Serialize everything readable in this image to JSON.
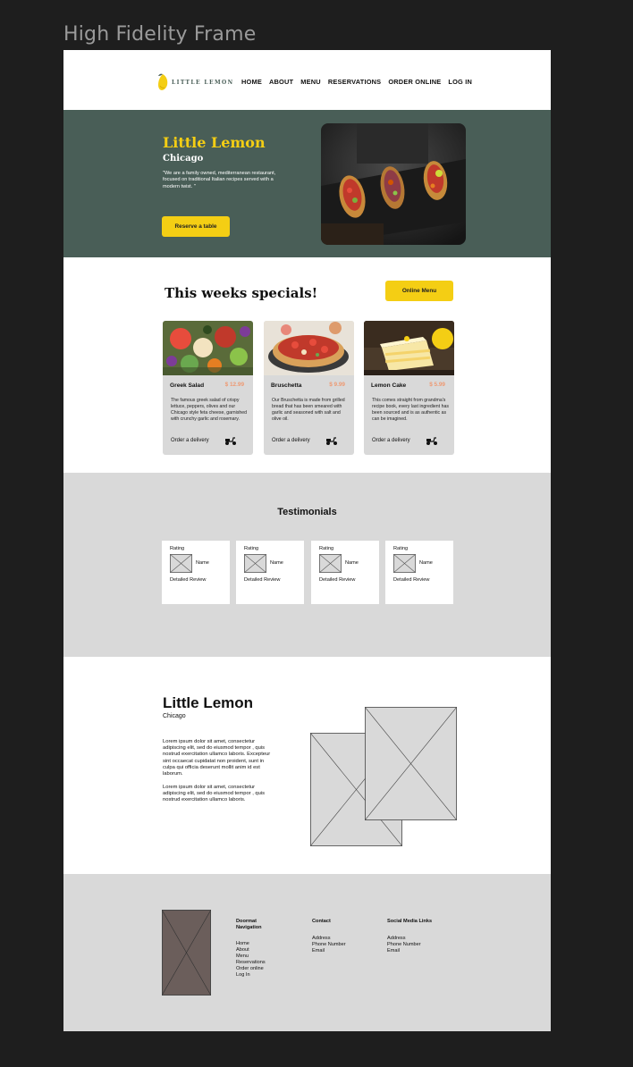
{
  "frame_label": "High Fidelity Frame",
  "nav": {
    "logo_text": "LITTLE LEMON",
    "items": [
      "HOME",
      "ABOUT",
      "MENU",
      "RESERVATIONS",
      "ORDER ONLINE",
      "LOG IN"
    ]
  },
  "hero": {
    "title": "Little Lemon",
    "subtitle": "Chicago",
    "description": "\"We are a family owned, mediterranean restaurant, focused on traditional Italian recipes served with a modern twist. \"",
    "button": "Reserve a table"
  },
  "specials": {
    "title": "This weeks specials!",
    "button": "Online Menu",
    "order_label": "Order a delivery",
    "cards": [
      {
        "name": "Greek Salad",
        "price": "$ 12.99",
        "desc": "The famous greek salad of crispy lettuce, peppers, olives and our Chicago style feta cheese, garnished with crunchy garlic and rosemary."
      },
      {
        "name": "Bruschetta",
        "price": "$ 9.99",
        "desc": "Our Bruschetta is made from grilled bread that has been smeared with garlic and seasoned with salt and olive oil."
      },
      {
        "name": "Lemon Cake",
        "price": "$ 5.99",
        "desc": "This comes straight from grandma's recipe book, every last ingredient has been sourced and is as authentic as can be imagined."
      }
    ]
  },
  "testimonials": {
    "title": "Testimonials",
    "cards": [
      {
        "rating": "Rating",
        "name": "Name",
        "review": "Detailed Review"
      },
      {
        "rating": "Rating",
        "name": "Name",
        "review": "Detailed Review"
      },
      {
        "rating": "Rating",
        "name": "Name",
        "review": "Detailed Review"
      },
      {
        "rating": "Rating",
        "name": "Name",
        "review": "Detailed Review"
      }
    ]
  },
  "about": {
    "title": "Little Lemon",
    "subtitle": "Chicago",
    "p1": "Lorem ipsum dolor sit amet, consectetur adipiscing elit, sed do eiusmod tempor , quis nostrud exercitation ullamco laboris. Excepteur sint occaecat cupidatat non proident, sunt in culpa qui officia deserunt mollit anim id est laborum.",
    "p2": "Lorem ipsum dolor sit amet, consectetur adipiscing elit, sed do eiusmod tempor , quis nostrud exercitation ullamco laboris."
  },
  "footer": {
    "nav_heading": "Doormat Navigation",
    "nav_items": [
      "Home",
      "About",
      "Menu",
      "Reservations",
      "Order online",
      "Log In"
    ],
    "contact_heading": "Contact",
    "contact_items": [
      "Address",
      "Phone Number",
      "Email"
    ],
    "social_heading": "Social Media Links",
    "social_items": [
      "Address",
      "Phone Number",
      "Email"
    ]
  },
  "colors": {
    "primary_green": "#495e57",
    "primary_yellow": "#f4ce14",
    "price_salmon": "#ee9972",
    "placeholder_gray": "#d9d9d9",
    "canvas_dark": "#1e1e1e"
  }
}
